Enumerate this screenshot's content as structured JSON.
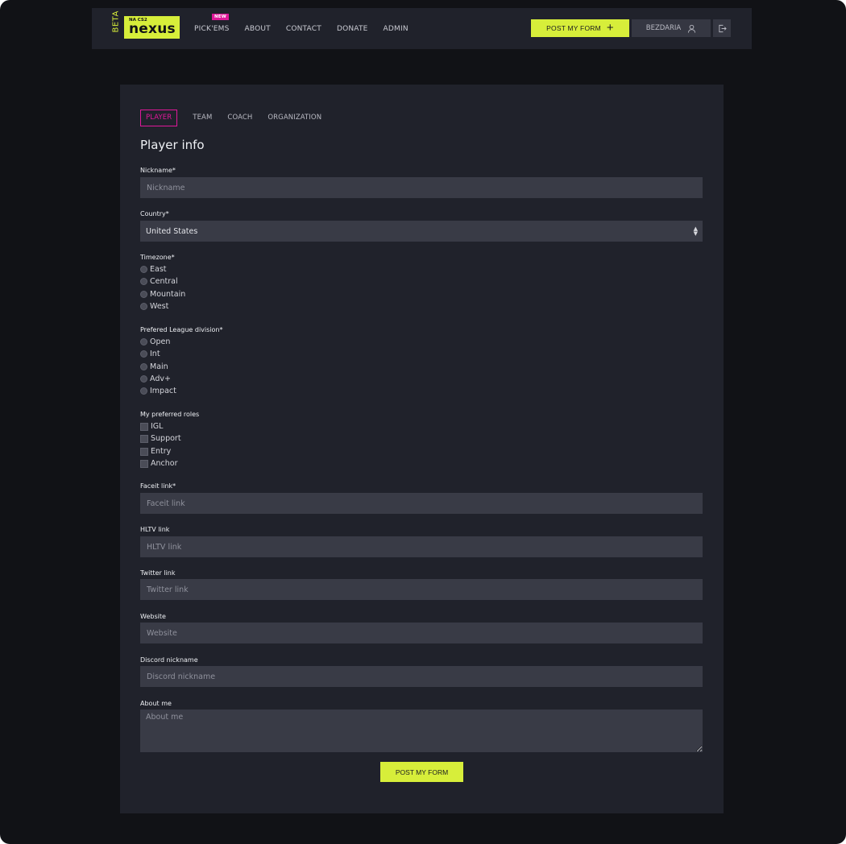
{
  "navbar": {
    "beta_label": "BETA",
    "logo_sub": "NA CS2",
    "logo_main": "nexus",
    "links": [
      "PICK'EMS",
      "ABOUT",
      "CONTACT",
      "DONATE",
      "ADMIN"
    ],
    "new_badge": "NEW",
    "post_button": "POST MY FORM",
    "username": "BEZDARIA"
  },
  "tabs": [
    "PLAYER",
    "TEAM",
    "COACH",
    "ORGANIZATION"
  ],
  "form": {
    "title": "Player info",
    "nickname": {
      "label": "Nickname*",
      "placeholder": "Nickname"
    },
    "country": {
      "label": "Country*",
      "value": "United States"
    },
    "timezone": {
      "label": "Timezone*",
      "options": [
        "East",
        "Central",
        "Mountain",
        "West"
      ]
    },
    "division": {
      "label": "Prefered League division*",
      "options": [
        "Open",
        "Int",
        "Main",
        "Adv+",
        "Impact"
      ]
    },
    "roles": {
      "label": "My preferred roles",
      "options": [
        "IGL",
        "Support",
        "Entry",
        "Anchor"
      ]
    },
    "faceit": {
      "label": "Faceit link*",
      "placeholder": "Faceit link"
    },
    "hltv": {
      "label": "HLTV link",
      "placeholder": "HLTV link"
    },
    "twitter": {
      "label": "Twitter link",
      "placeholder": "Twitter link"
    },
    "website": {
      "label": "Website",
      "placeholder": "Website"
    },
    "discord": {
      "label": "Discord nickname",
      "placeholder": "Discord nickname"
    },
    "about": {
      "label": "About me",
      "placeholder": "About me"
    },
    "submit": "POST MY FORM"
  },
  "colors": {
    "accent": "#d7ee3a",
    "highlight": "#e0189a",
    "background": "#111216",
    "card": "#20222b"
  }
}
